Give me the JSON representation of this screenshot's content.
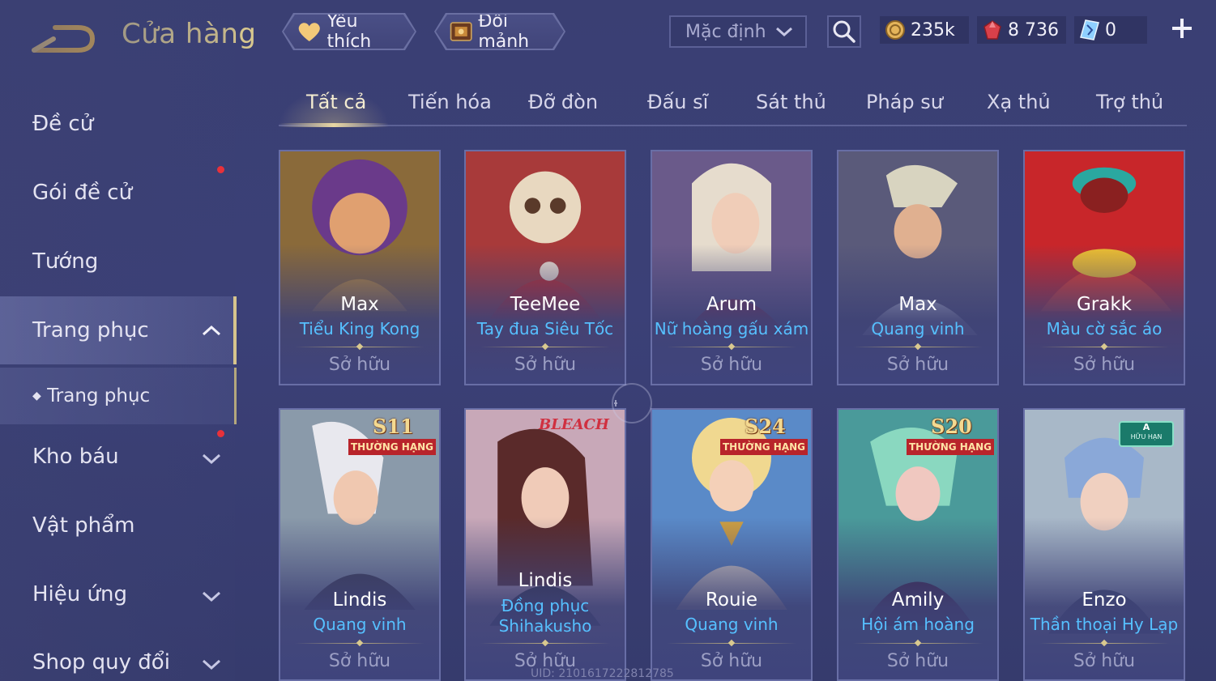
{
  "header": {
    "title": "Cửa hàng",
    "favorites_label": "Yêu thích",
    "exchange_label": "Đổi mảnh",
    "sort_value": "Mặc định"
  },
  "currencies": [
    {
      "icon": "gold-coin-icon",
      "value": "235k"
    },
    {
      "icon": "ruby-gem-icon",
      "value": "8 736"
    },
    {
      "icon": "voucher-crystal-icon",
      "value": "0"
    }
  ],
  "sidebar": {
    "items": [
      {
        "label": "Đề cử"
      },
      {
        "label": "Gói đề cử"
      },
      {
        "label": "Tướng"
      },
      {
        "label": "Trang phục"
      },
      {
        "label": "Trang phục"
      },
      {
        "label": "Kho báu"
      },
      {
        "label": "Vật phẩm"
      },
      {
        "label": "Hiệu ứng"
      },
      {
        "label": "Shop quy đổi"
      }
    ]
  },
  "tabs": [
    {
      "label": "Tất cả"
    },
    {
      "label": "Tiến hóa"
    },
    {
      "label": "Đỡ đòn"
    },
    {
      "label": "Đấu sĩ"
    },
    {
      "label": "Sát thủ"
    },
    {
      "label": "Pháp sư"
    },
    {
      "label": "Xạ thủ"
    },
    {
      "label": "Trợ thủ"
    }
  ],
  "cards": [
    {
      "hero": "Max",
      "skin": "Tiểu King Kong",
      "status": "Sở hữu"
    },
    {
      "hero": "TeeMee",
      "skin": "Tay đua Siêu Tốc",
      "status": "Sở hữu"
    },
    {
      "hero": "Arum",
      "skin": "Nữ hoàng gấu xám",
      "status": "Sở hữu"
    },
    {
      "hero": "Max",
      "skin": "Quang vinh",
      "status": "Sở hữu"
    },
    {
      "hero": "Grakk",
      "skin": "Màu cờ sắc áo",
      "status": "Sở hữu"
    },
    {
      "hero": "Lindis",
      "skin": "Quang vinh",
      "status": "Sở hữu",
      "badge_season": "S11",
      "badge_rank": "THƯỜNG HẠNG"
    },
    {
      "hero": "Lindis",
      "skin": "Đồng phục",
      "skin2": "Shihakusho",
      "status": "Sở hữu",
      "badge_brand": "BLEACH"
    },
    {
      "hero": "Rouie",
      "skin": "Quang vinh",
      "status": "Sở hữu",
      "badge_season": "S24",
      "badge_rank": "THƯỜNG HẠNG"
    },
    {
      "hero": "Amily",
      "skin": "Hội ám hoàng",
      "status": "Sở hữu",
      "badge_season": "S20",
      "badge_rank": "THƯỜNG HẠNG"
    },
    {
      "hero": "Enzo",
      "skin": "Thần thoại Hy Lạp",
      "status": "Sở hữu",
      "badge_tier": "A",
      "badge_tier_label": "HỮU HẠN"
    }
  ],
  "footer": {
    "uid": "UID: 2101617222812785"
  },
  "colors": {
    "accent_gold": "#d6c48d",
    "skin_name_blue": "#56c0ff",
    "notification_red": "#e8313a"
  }
}
